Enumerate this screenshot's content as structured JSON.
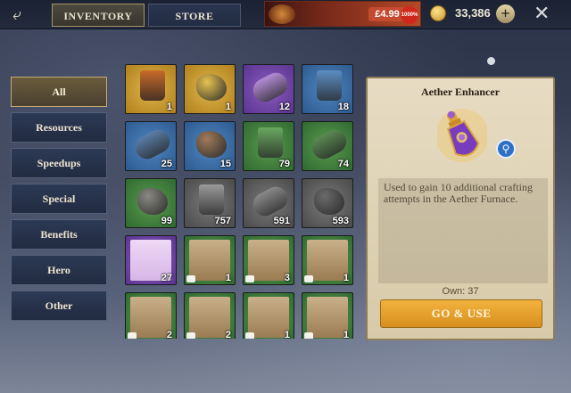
{
  "header": {
    "tabs": [
      {
        "label": "INVENTORY",
        "active": true
      },
      {
        "label": "STORE",
        "active": false
      }
    ],
    "offer": {
      "price": "£4.99",
      "badge": "1000%"
    },
    "gold": "33,386"
  },
  "categories": [
    {
      "label": "All",
      "active": true
    },
    {
      "label": "Resources"
    },
    {
      "label": "Speedups"
    },
    {
      "label": "Special"
    },
    {
      "label": "Benefits"
    },
    {
      "label": "Hero"
    },
    {
      "label": "Other"
    }
  ],
  "items": [
    {
      "type": "bucket",
      "rarity": "gold",
      "color": "#c86a2a",
      "count": "1"
    },
    {
      "type": "ore",
      "rarity": "gold",
      "color": "#e8c350",
      "count": "1"
    },
    {
      "type": "roll",
      "rarity": "purple",
      "color": "#b48cd6",
      "count": "12"
    },
    {
      "type": "bucket",
      "rarity": "blue",
      "color": "#5c8ec2",
      "count": "18"
    },
    {
      "type": "roll",
      "rarity": "blue",
      "color": "#5a7ea8",
      "count": "25"
    },
    {
      "type": "ore",
      "rarity": "blue",
      "color": "#a07a5a",
      "count": "15"
    },
    {
      "type": "bucket",
      "rarity": "green",
      "color": "#6aa860",
      "count": "79"
    },
    {
      "type": "roll",
      "rarity": "green",
      "color": "#5a8a52",
      "count": "74"
    },
    {
      "type": "rock",
      "rarity": "green",
      "color": "#8a8a82",
      "count": "99"
    },
    {
      "type": "bucket",
      "rarity": "gray",
      "color": "#9a9a9a",
      "count": "757"
    },
    {
      "type": "roll",
      "rarity": "gray",
      "color": "#8a8a8a",
      "count": "591"
    },
    {
      "type": "rock",
      "rarity": "gray",
      "color": "#6a6a6a",
      "count": "593"
    },
    {
      "type": "book",
      "rarity": "purple",
      "color": "#d7b6e6",
      "count": "27"
    },
    {
      "type": "sketch",
      "rarity": "green",
      "color": "#c9b08a",
      "count": "1"
    },
    {
      "type": "sketch",
      "rarity": "green",
      "color": "#c9b08a",
      "count": "3"
    },
    {
      "type": "sketch",
      "rarity": "green",
      "color": "#c9b08a",
      "count": "1"
    },
    {
      "type": "sketch",
      "rarity": "green",
      "color": "#c9b08a",
      "count": "2"
    },
    {
      "type": "sketch",
      "rarity": "green",
      "color": "#c9b08a",
      "count": "2"
    },
    {
      "type": "sketch",
      "rarity": "green",
      "color": "#c9b08a",
      "count": "1"
    },
    {
      "type": "sketch",
      "rarity": "green",
      "color": "#c9b08a",
      "count": "1"
    }
  ],
  "detail": {
    "title": "Aether Enhancer",
    "description": "Used to gain 10 additional crafting attempts in the Aether Furnace.",
    "own": "Own: 37",
    "button": "GO & USE"
  }
}
